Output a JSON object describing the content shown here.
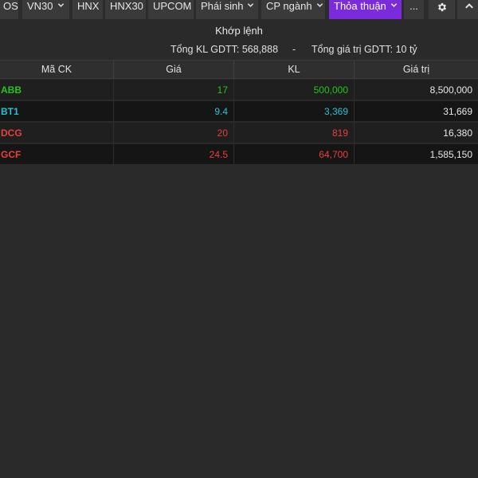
{
  "tabs": [
    {
      "label": "OSE",
      "chevron": false,
      "active": false
    },
    {
      "label": "VN30",
      "chevron": true,
      "active": false
    },
    {
      "label": "HNX",
      "chevron": false,
      "active": false
    },
    {
      "label": "HNX30",
      "chevron": false,
      "active": false
    },
    {
      "label": "UPCOM",
      "chevron": false,
      "active": false
    },
    {
      "label": "Phái sinh",
      "chevron": true,
      "active": false
    },
    {
      "label": "CP ngành",
      "chevron": true,
      "active": false
    },
    {
      "label": "Thỏa thuận",
      "chevron": true,
      "active": true
    },
    {
      "label": "...",
      "chevron": false,
      "active": false
    }
  ],
  "icons": {
    "settings": "gear-icon",
    "collapse": "chevron-up-icon"
  },
  "section_title": "Khớp lệnh",
  "summary": {
    "total_volume": "Tổng KL GDTT: 568,888",
    "separator": "-",
    "total_value": "Tổng giá trị GDTT: 10 tỷ"
  },
  "table": {
    "headers": [
      "Mã CK",
      "Giá",
      "KL",
      "Giá trị"
    ],
    "rows": [
      {
        "symbol": "ABB",
        "price": "17",
        "volume": "500,000",
        "value": "8,500,000",
        "color": "#22c51c"
      },
      {
        "symbol": "BT1",
        "price": "9.4",
        "volume": "3,369",
        "value": "31,669",
        "color": "#27c2cf"
      },
      {
        "symbol": "DCG",
        "price": "20",
        "volume": "819",
        "value": "16,380",
        "color": "#e8403b"
      },
      {
        "symbol": "GCF",
        "price": "24.5",
        "volume": "64,700",
        "value": "1,585,150",
        "color": "#e8403b"
      }
    ]
  },
  "colors": {
    "accent": "#7b2bd9",
    "value_text": "#e8e8e8"
  }
}
